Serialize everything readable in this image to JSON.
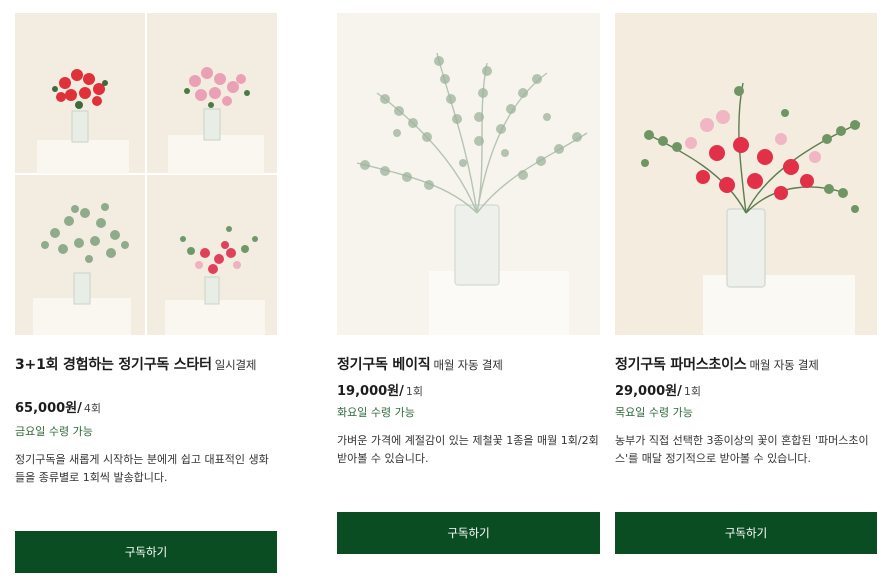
{
  "products": [
    {
      "title": "3+1회 경험하는 정기구독 스타터",
      "subtitle": "일시결제",
      "price": "65,000원/",
      "price_unit": "4회",
      "delivery_day": "금요일 수령 가능",
      "description": "정기구독을 새롭게 시작하는 분에게 쉽고 대표적인 생화들을 종류별로 1회씩 발송합니다.",
      "button_label": "구독하기",
      "image_icon": "flower-collage-image"
    },
    {
      "title": "정기구독 베이직",
      "subtitle": "매월 자동 결제",
      "price": "19,000원/",
      "price_unit": "1회",
      "delivery_day": "화요일 수령 가능",
      "description": "가벼운 가격에 계절감이 있는 제철꽃 1종을 매월 1회/2회 받아볼 수 있습니다.",
      "button_label": "구독하기",
      "image_icon": "eucalyptus-vase-image"
    },
    {
      "title": "정기구독 파머스초이스",
      "subtitle": "매월 자동 결제",
      "price": "29,000원/",
      "price_unit": "1회",
      "delivery_day": "목요일 수령 가능",
      "description": "농부가 직접 선택한 3종이상의 꽃이 혼합된 '파머스초이스'를 매달 정기적으로 받아볼 수 있습니다.",
      "button_label": "구독하기",
      "image_icon": "mixed-bouquet-image"
    }
  ],
  "colors": {
    "button_bg": "#0b4d23",
    "delivery_text": "#2d6a3b",
    "photo_bg": "#f4eee2"
  }
}
